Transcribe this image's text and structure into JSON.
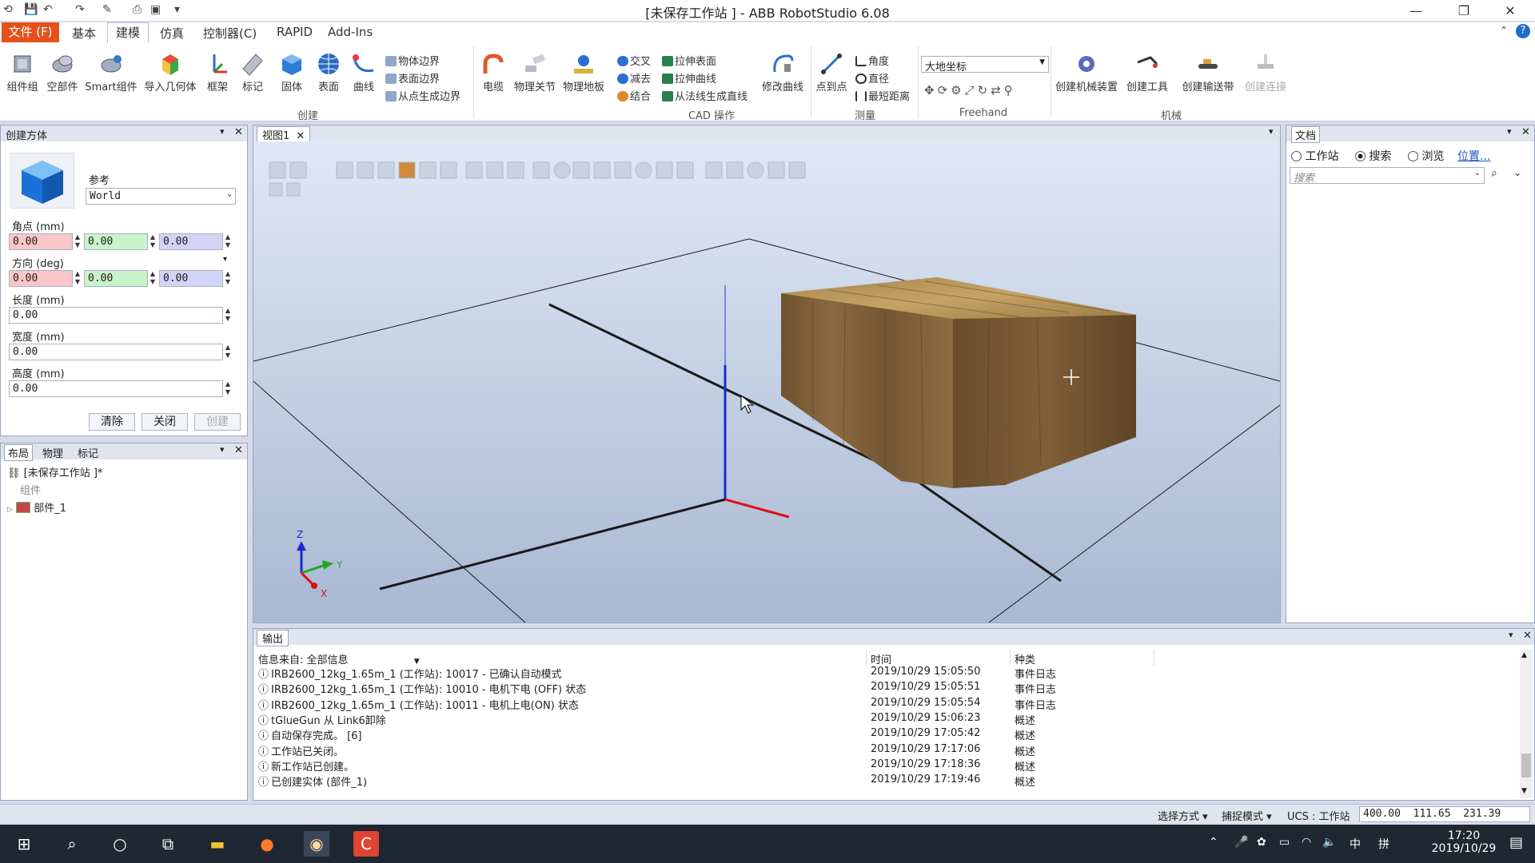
{
  "window": {
    "title": "[未保存工作站 ] - ABB RobotStudio 6.08"
  },
  "tabs": [
    {
      "label": "文件 (F)"
    },
    {
      "label": "基本"
    },
    {
      "label": "建模"
    },
    {
      "label": "仿真"
    },
    {
      "label": "控制器(C)"
    },
    {
      "label": "RAPID"
    },
    {
      "label": "Add-Ins"
    }
  ],
  "ribbon": {
    "create_buttons": [
      {
        "label": "组件组"
      },
      {
        "label": "空部件"
      },
      {
        "label": "Smart组件"
      },
      {
        "label": "导入几何体"
      },
      {
        "label": "框架"
      },
      {
        "label": "标记"
      },
      {
        "label": "固体"
      },
      {
        "label": "表面"
      },
      {
        "label": "曲线"
      }
    ],
    "create_small": [
      "物体边界",
      "表面边界",
      "从点生成边界"
    ],
    "create_group": "创建",
    "cad_buttons": [
      {
        "label": "电缆"
      },
      {
        "label": "物理关节"
      },
      {
        "label": "物理地板"
      }
    ],
    "cad_small_a": [
      "交叉",
      "减去",
      "结合"
    ],
    "cad_small_b": [
      "拉伸表面",
      "拉伸曲线",
      "从法线生成直线"
    ],
    "cad_modify": "修改曲线",
    "cad_group": "CAD 操作",
    "measure_button": "点到点",
    "measure_small": [
      "角度",
      "直径",
      "最短距离"
    ],
    "measure_group": "测量",
    "freehand_select": "大地坐标",
    "freehand_group": "Freehand",
    "mech_buttons": [
      {
        "label": "创建机械装置"
      },
      {
        "label": "创建工具"
      },
      {
        "label": "创建输送带"
      },
      {
        "label": "创建连接"
      }
    ],
    "mech_group": "机械"
  },
  "create_box": {
    "title": "创建方体",
    "reference_label": "参考",
    "reference_value": "World",
    "corner_label": "角点 (mm)",
    "corner": [
      "0.00",
      "0.00",
      "0.00"
    ],
    "direction_label": "方向 (deg)",
    "direction": [
      "0.00",
      "0.00",
      "0.00"
    ],
    "length_label": "长度 (mm)",
    "length": "0.00",
    "width_label": "宽度 (mm)",
    "width": "0.00",
    "height_label": "高度 (mm)",
    "height": "0.00",
    "clear_btn": "清除",
    "close_btn": "关闭",
    "create_btn": "创建"
  },
  "layout_panel": {
    "tabs": [
      "布局",
      "物理",
      "标记"
    ],
    "root": "[未保存工作站 ]*",
    "group": "组件",
    "part": "部件_1"
  },
  "viewport": {
    "tab": "视图1",
    "axis_x": "X",
    "axis_y": "Y",
    "axis_z": "Z"
  },
  "docs": {
    "title": "文档",
    "opt_station": "工作站",
    "opt_search": "搜索",
    "opt_browse": "浏览",
    "location": "位置...",
    "search_placeholder": "搜索"
  },
  "output": {
    "title": "输出",
    "source_label": "信息来自:",
    "source_value": "全部信息",
    "col_time": "时间",
    "col_type": "种类",
    "rows": [
      {
        "msg": "IRB2600_12kg_1.65m_1 (工作站): 10017 - 已确认自动模式",
        "time": "2019/10/29 15:05:50",
        "type": "事件日志"
      },
      {
        "msg": "IRB2600_12kg_1.65m_1 (工作站): 10010 - 电机下电 (OFF) 状态",
        "time": "2019/10/29 15:05:51",
        "type": "事件日志"
      },
      {
        "msg": "IRB2600_12kg_1.65m_1 (工作站): 10011 - 电机上电(ON) 状态",
        "time": "2019/10/29 15:05:54",
        "type": "事件日志"
      },
      {
        "msg": "tGlueGun 从 Link6卸除",
        "time": "2019/10/29 15:06:23",
        "type": "概述"
      },
      {
        "msg": "自动保存完成。 [6]",
        "time": "2019/10/29 17:05:42",
        "type": "概述"
      },
      {
        "msg": "工作站已关闭。",
        "time": "2019/10/29 17:17:06",
        "type": "概述"
      },
      {
        "msg": "新工作站已创建。",
        "time": "2019/10/29 17:18:36",
        "type": "概述"
      },
      {
        "msg": "已创建实体 (部件_1)",
        "time": "2019/10/29 17:19:46",
        "type": "概述"
      }
    ]
  },
  "status": {
    "select_mode": "选择方式",
    "snap_mode": "捕捉模式",
    "ucs": "UCS : 工作站",
    "coords": "400.00  111.65  231.39"
  },
  "taskbar": {
    "ime": "中",
    "ime2": "拼",
    "time": "17:20",
    "date": "2019/10/29"
  }
}
